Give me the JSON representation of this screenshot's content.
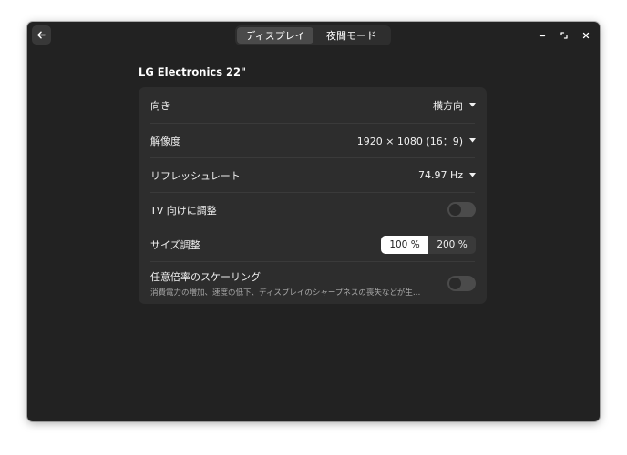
{
  "header": {
    "tabs": [
      {
        "label": "ディスプレイ",
        "active": true
      },
      {
        "label": "夜間モード",
        "active": false
      }
    ]
  },
  "monitor": {
    "name": "LG Electronics 22\""
  },
  "settings": {
    "orientation": {
      "label": "向き",
      "value": "横方向"
    },
    "resolution": {
      "label": "解像度",
      "value": "1920 × 1080 (16：9)"
    },
    "refresh_rate": {
      "label": "リフレッシュレート",
      "value": "74.97 Hz"
    },
    "tv_adjust": {
      "label": "TV 向けに調整",
      "enabled": false
    },
    "scale": {
      "label": "サイズ調整",
      "options": [
        "100 %",
        "200 %"
      ],
      "selected": "100 %"
    },
    "fractional_scaling": {
      "label": "任意倍率のスケーリング",
      "description": "消費電力の増加、速度の低下、ディスプレイのシャープネスの喪失などが生…",
      "enabled": false
    }
  },
  "icons": {
    "back": "back-arrow-icon",
    "minimize": "minimize-icon",
    "maximize": "maximize-icon",
    "close": "close-icon",
    "dropdown": "chevron-down-icon"
  },
  "colors": {
    "window_bg": "#222222",
    "list_bg": "#2d2d2d",
    "toggle_off": "#4b4b4b",
    "selected_segment": "#ffffff"
  }
}
